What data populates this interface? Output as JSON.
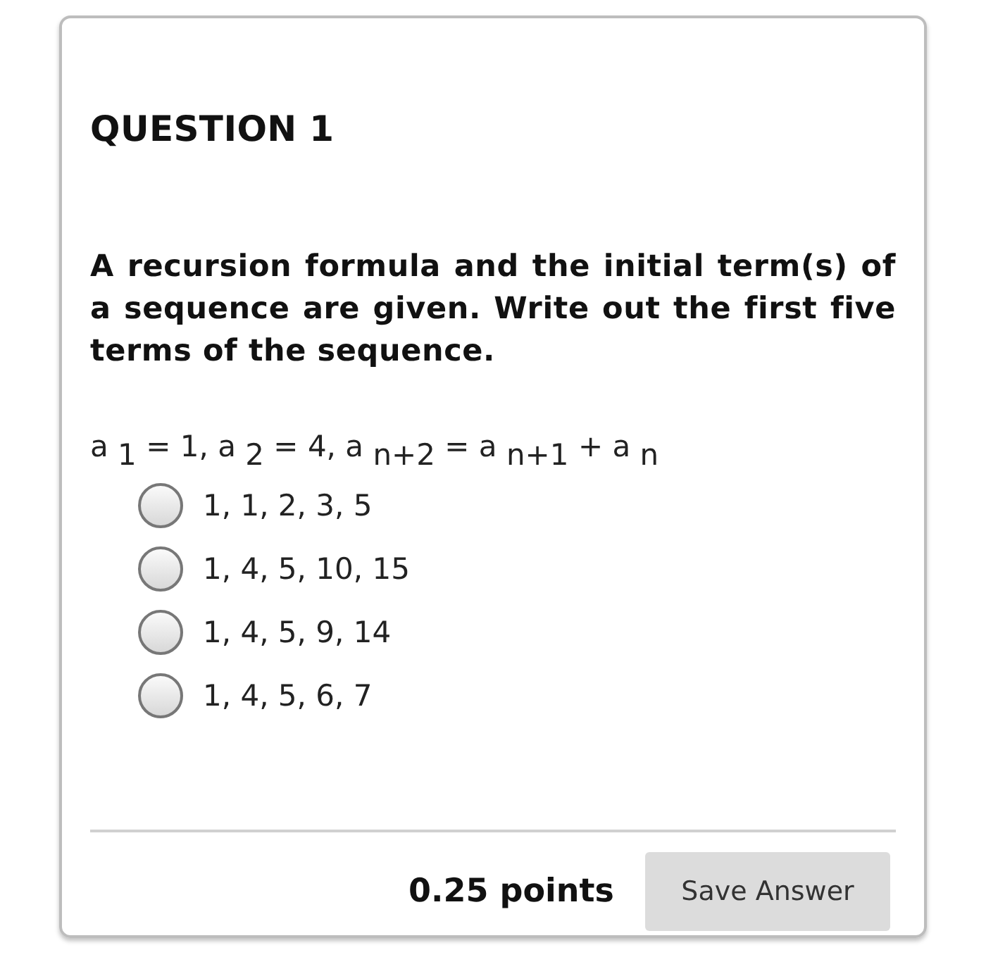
{
  "question": {
    "title": "QUESTION 1",
    "prompt": "A recursion formula and the initial term(s) of a sequence are given. Write out the first five terms of the sequence.",
    "formula": "a $_{1}$ = 1, a $_{2}$ = 4, a $_{n+2}$ = a $_{n+1}$ + a $_{n}$",
    "options": [
      {
        "label": "1, 1, 2, 3, 5",
        "selected": false
      },
      {
        "label": "1, 4, 5, 10, 15",
        "selected": false
      },
      {
        "label": "1, 4, 5, 9, 14",
        "selected": false
      },
      {
        "label": "1, 4, 5, 6, 7",
        "selected": false
      }
    ]
  },
  "footer": {
    "points": "0.25 points",
    "button": "Save Answer"
  }
}
